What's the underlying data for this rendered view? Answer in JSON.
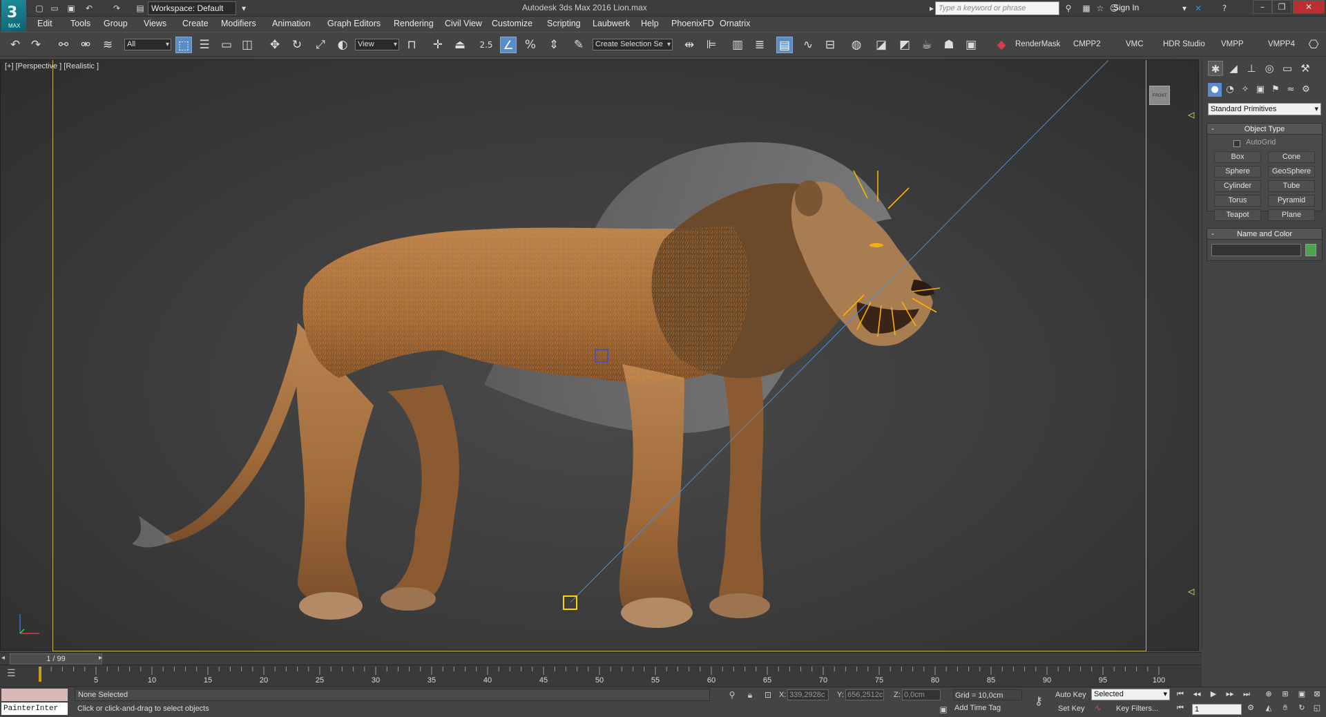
{
  "titlebar": {
    "app_logo_text": "3",
    "app_logo_sub": "MAX",
    "workspace": "Workspace: Default",
    "window_title": "Autodesk 3ds Max 2016     Lion.max",
    "search_placeholder": "Type a keyword or phrase",
    "sign_in": "Sign In"
  },
  "menu": [
    "Edit",
    "Tools",
    "Group",
    "Views",
    "Create",
    "Modifiers",
    "Animation",
    "Graph Editors",
    "Rendering",
    "Civil View",
    "Customize",
    "Scripting",
    "Laubwerk",
    "Help",
    "PhoenixFD",
    "Ornatrix"
  ],
  "toolbar": {
    "selection_filter": "All",
    "reference_coord": "View",
    "snap_value": "2.5",
    "named_selection": "Create Selection Se",
    "plugin_labels": [
      "RenderMask",
      "CMPP2",
      "VMC",
      "HDR Studio",
      "VMPP",
      "VMPP4"
    ]
  },
  "viewport": {
    "label": "[+] [Perspective ] [Realistic ]",
    "viewcube_label": "FRONT"
  },
  "command_panel": {
    "primitive_type": "Standard Primitives",
    "object_type_title": "Object Type",
    "autogrid_label": "AutoGrid",
    "buttons": [
      "Box",
      "Cone",
      "Sphere",
      "GeoSphere",
      "Cylinder",
      "Tube",
      "Torus",
      "Pyramid",
      "Teapot",
      "Plane"
    ],
    "name_color_title": "Name and Color",
    "object_color": "#4aa64a"
  },
  "timeline": {
    "frame_counter": "1 / 99",
    "ticks": [
      "5",
      "10",
      "15",
      "20",
      "25",
      "30",
      "35",
      "40",
      "45",
      "50",
      "55",
      "60",
      "65",
      "70",
      "75",
      "80",
      "85",
      "90",
      "95",
      "100"
    ]
  },
  "status": {
    "maxscript": "PainterInter",
    "selection": "None Selected",
    "prompt": "Click or click-and-drag to select objects",
    "x_label": "X:",
    "x_value": "339,2928c",
    "y_label": "Y:",
    "y_value": "656,2512c",
    "z_label": "Z:",
    "z_value": "0,0cm",
    "grid": "Grid = 10,0cm",
    "add_time_tag": "Add Time Tag",
    "auto_key": "Auto Key",
    "set_key": "Set Key",
    "key_mode": "Selected",
    "key_filters": "Key Filters...",
    "current_frame": "1"
  }
}
